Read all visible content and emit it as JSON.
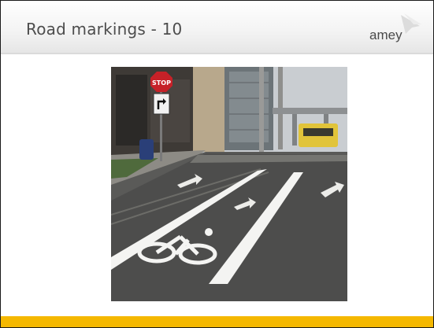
{
  "slide": {
    "title": "Road markings - 10",
    "logo_text": "amey",
    "accent_color": "#f5b800"
  },
  "photo": {
    "stop_sign_text": "STOP"
  }
}
